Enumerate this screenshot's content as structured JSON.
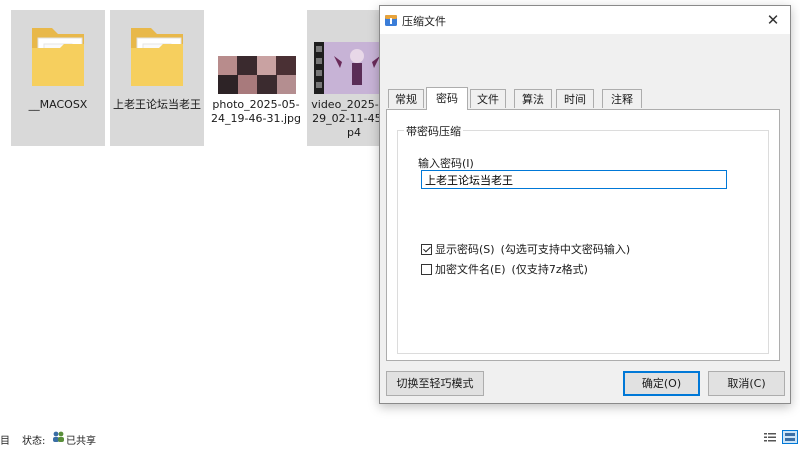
{
  "explorer": {
    "items": [
      {
        "name": "__MACOSX",
        "type": "folder",
        "selected": true
      },
      {
        "name": "上老王论坛当老王",
        "type": "folder",
        "selected": true
      },
      {
        "name": "photo_2025-05-24_19-46-31.jpg",
        "type": "image",
        "selected": false
      },
      {
        "name": "video_2025-05-29_02-11-45.mp4",
        "type": "video",
        "selected": true
      }
    ],
    "status_fragment": "目",
    "status_label": "状态:",
    "status_value": "已共享"
  },
  "dialog": {
    "title": "压缩文件",
    "close_glyph": "✕",
    "tabs": [
      {
        "label": "常规",
        "active": false
      },
      {
        "label": "密码",
        "active": true
      },
      {
        "label": "文件",
        "active": false
      },
      {
        "label": "算法",
        "active": false
      },
      {
        "label": "时间",
        "active": false
      },
      {
        "label": "注释",
        "active": false
      }
    ],
    "group_title": "带密码压缩",
    "password_label": "输入密码(I)",
    "password_value": "上老王论坛当老王",
    "show_password": {
      "label": "显示密码(S)",
      "note": "(勾选可支持中文密码输入)",
      "checked": true
    },
    "encrypt_names": {
      "label": "加密文件名(E)",
      "note": "(仅支持7z格式)",
      "checked": false
    },
    "switch_button": "切换至轻巧模式",
    "ok_button": "确定(O)",
    "cancel_button": "取消(C)"
  },
  "colors": {
    "accent": "#0078d7",
    "folder": "#f6cf5e",
    "selection": "#d9d9d9",
    "dialog_bg": "#f0f0f0",
    "video_thumb": "#c7b3d6"
  }
}
